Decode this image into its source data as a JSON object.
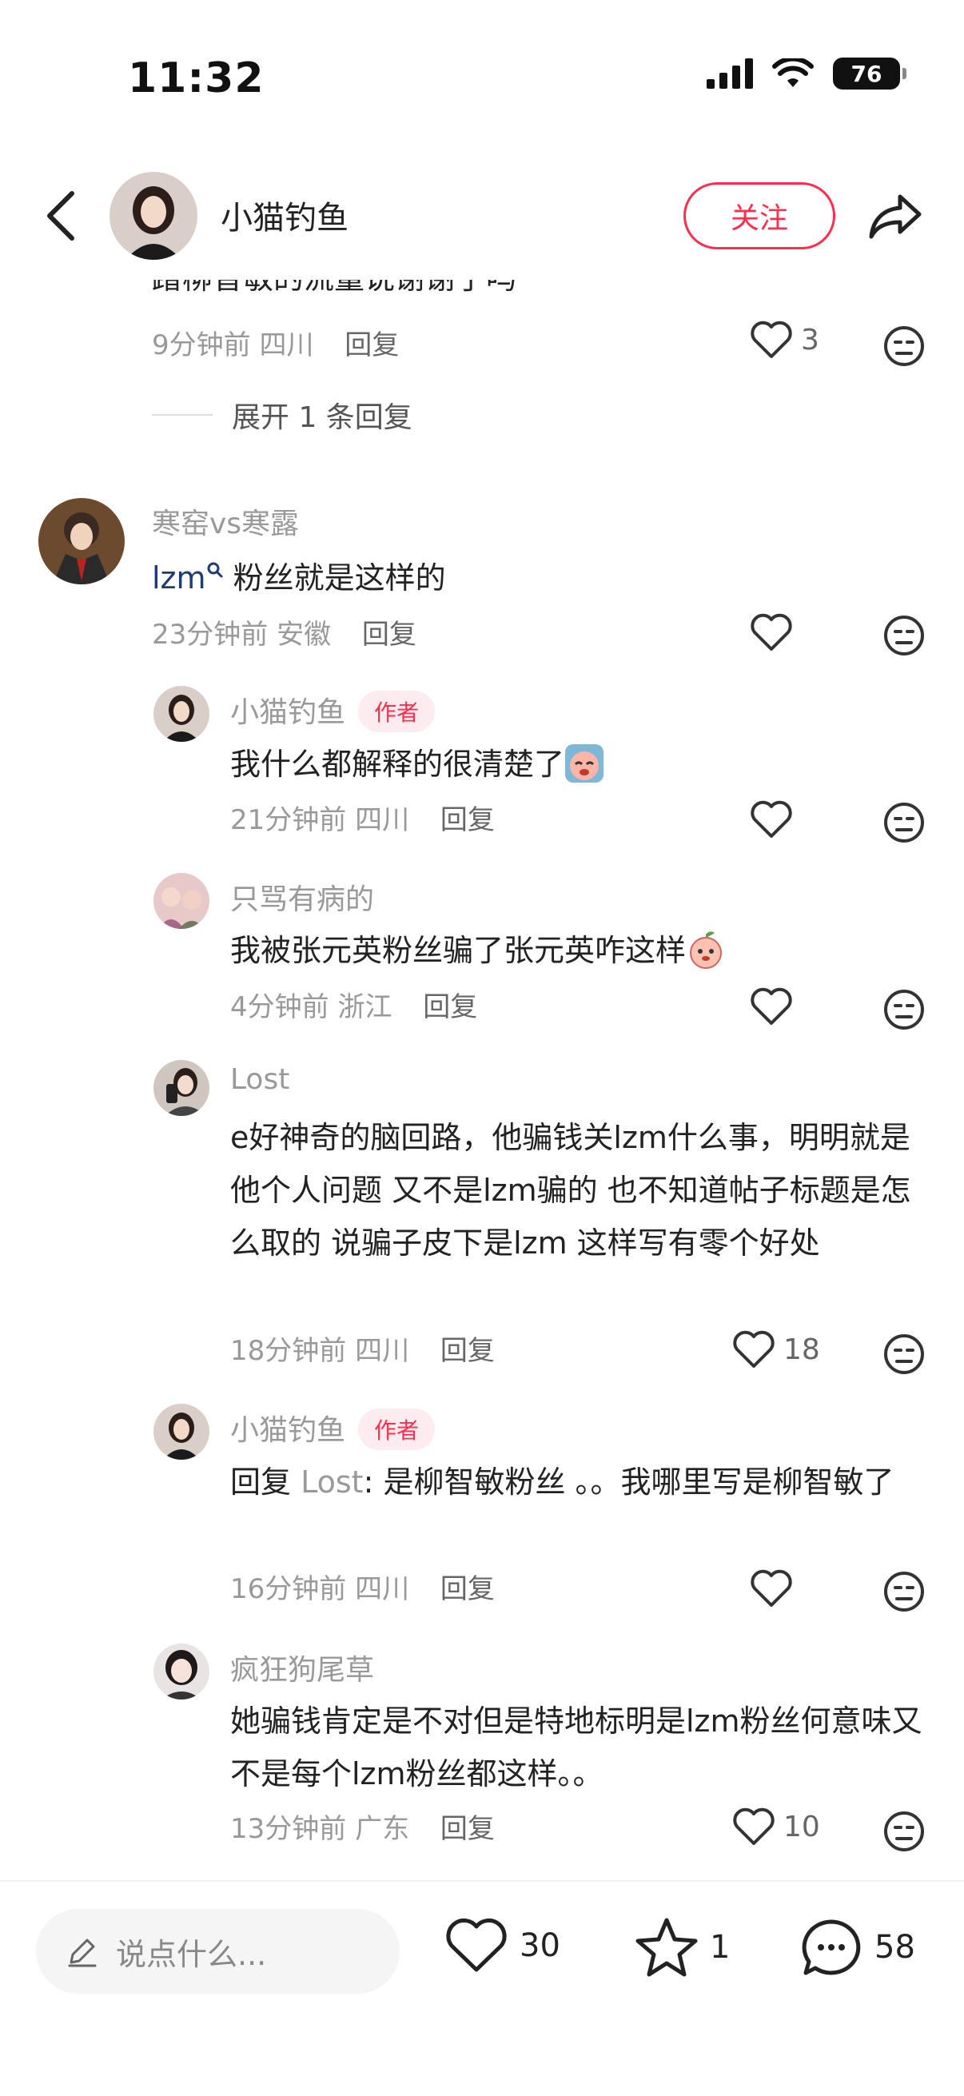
{
  "status_bar": {
    "time": "11:32",
    "battery": "76"
  },
  "header": {
    "author_name": "小猫钓鱼",
    "follow_label": "关注"
  },
  "comments": [
    {
      "text": "蹭柳智敏的流量说谢谢了吗",
      "time": "9分钟前",
      "location": "四川",
      "reply_label": "回复",
      "likes": "3",
      "expand_label": "展开 1 条回复"
    },
    {
      "user": "寒窑vs寒露",
      "mention": "lzm",
      "text": "粉丝就是这样的",
      "time": "23分钟前",
      "location": "安徽",
      "reply_label": "回复",
      "replies": [
        {
          "user": "小猫钓鱼",
          "author_tag": "作者",
          "text": "我什么都解释的很清楚了",
          "time": "21分钟前",
          "location": "四川",
          "reply_label": "回复"
        },
        {
          "user": "只骂有病的",
          "text": "我被张元英粉丝骗了张元英咋这样",
          "time": "4分钟前",
          "location": "浙江",
          "reply_label": "回复"
        },
        {
          "user": "Lost",
          "text": "e好神奇的脑回路，他骗钱关lzm什么事，明明就是他个人问题 又不是lzm骗的 也不知道帖子标题是怎么取的 说骗子皮下是lzm 这样写有零个好处",
          "time": "18分钟前",
          "location": "四川",
          "reply_label": "回复",
          "likes": "18"
        },
        {
          "user": "小猫钓鱼",
          "author_tag": "作者",
          "reply_prefix": "回复",
          "reply_to": "Lost",
          "text": ": 是柳智敏粉丝 。。我哪里写是柳智敏了",
          "time": "16分钟前",
          "location": "四川",
          "reply_label": "回复"
        },
        {
          "user": "疯狂狗尾草",
          "text": "她骗钱肯定是不对但是特地标明是lzm粉丝何意味又不是每个lzm粉丝都这样。。",
          "time": "13分钟前",
          "location": "广东",
          "reply_label": "回复",
          "likes": "10"
        }
      ]
    }
  ],
  "bottom_bar": {
    "input_placeholder": "说点什么...",
    "likes": "30",
    "stars": "1",
    "comments": "58"
  },
  "colors": {
    "accent": "#ff2e4d",
    "meta_text": "#999999",
    "mention": "#1f3b73"
  },
  "icons": [
    "back-arrow-icon",
    "share-icon",
    "heart-icon",
    "dislike-face-icon",
    "pencil-icon",
    "star-icon",
    "comment-bubble-icon",
    "signal-icon",
    "wifi-icon",
    "battery-icon"
  ]
}
